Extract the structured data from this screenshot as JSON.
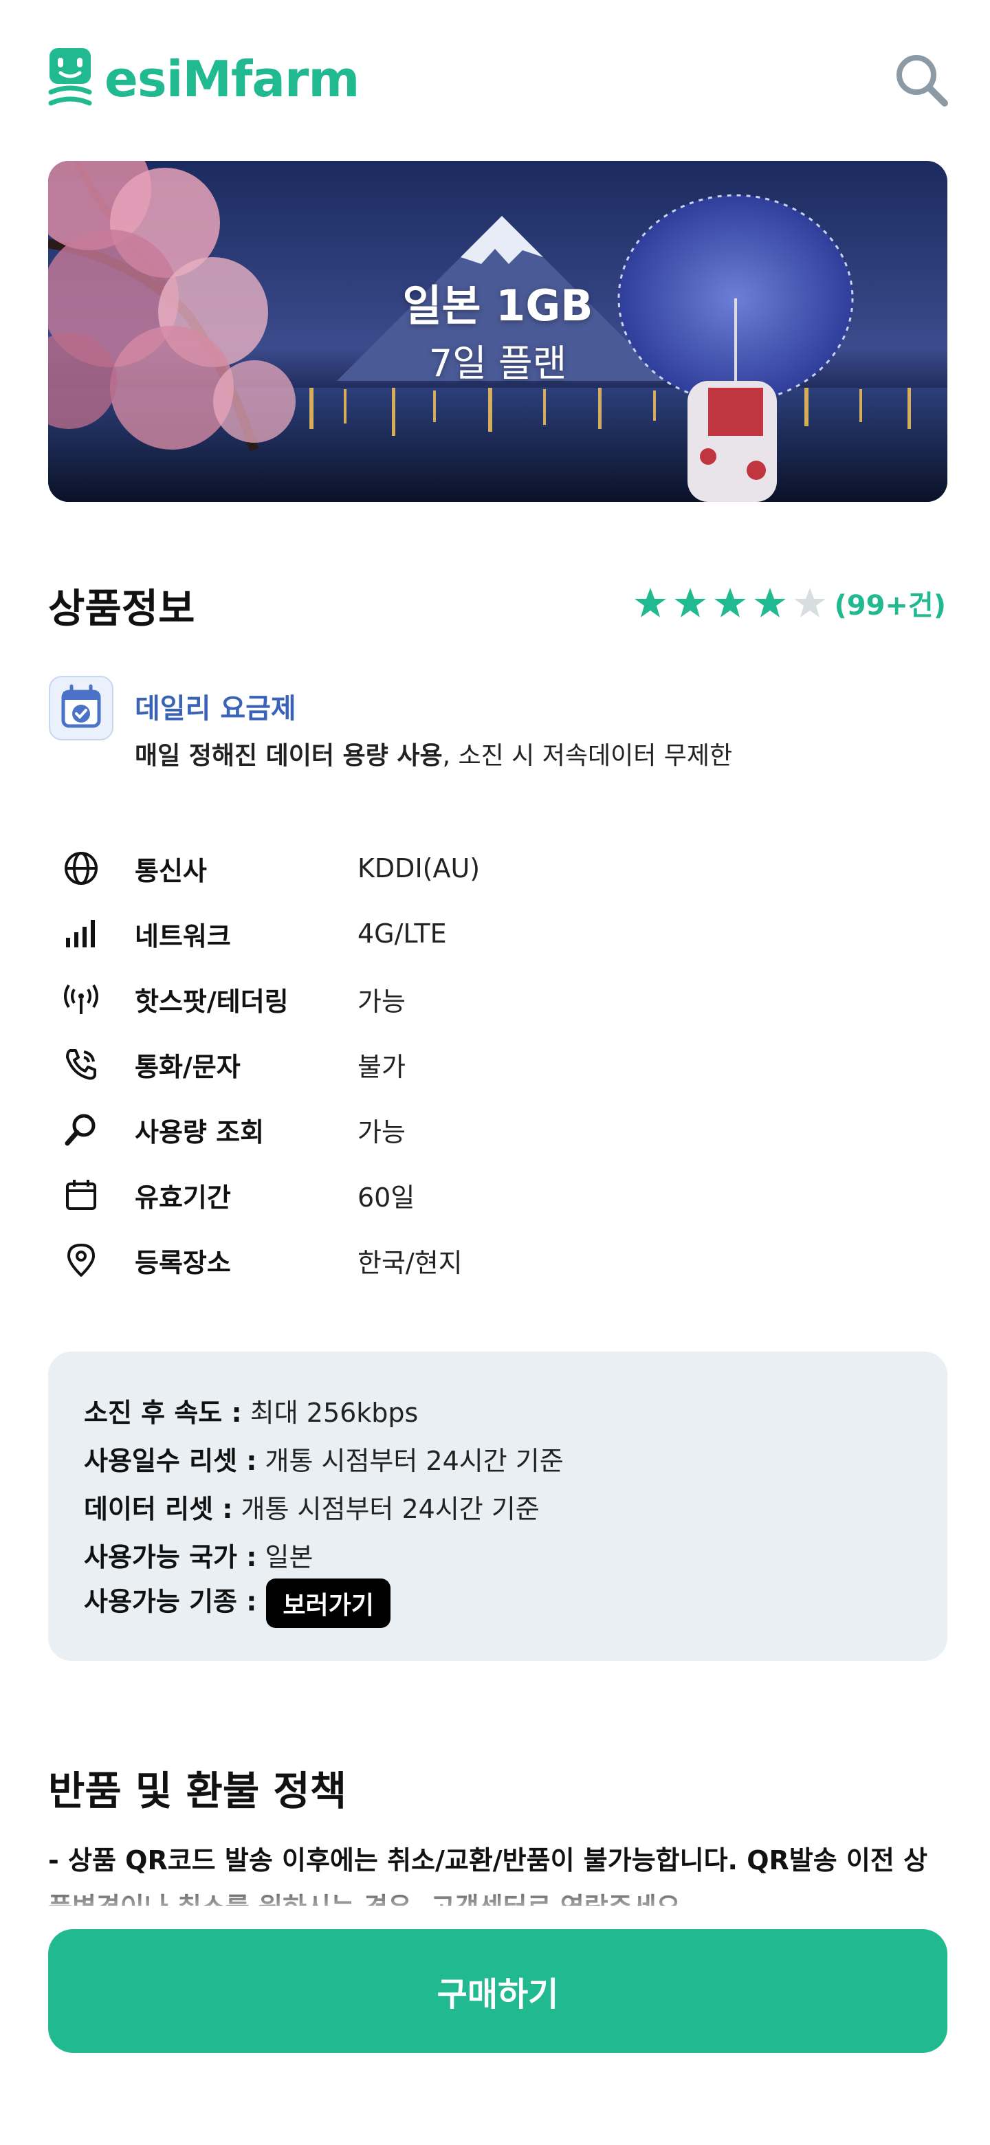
{
  "header": {
    "logo_text": "esiMfarm",
    "brand_color": "#21b98f",
    "search_icon": "search-icon"
  },
  "hero": {
    "title": "일본 1GB",
    "subtitle": "7일 플랜"
  },
  "product_info": {
    "title": "상품정보",
    "rating": {
      "stars": 4,
      "max": 5,
      "count_text": "(99+건)"
    }
  },
  "plan": {
    "icon": "calendar-check-icon",
    "name": "데일리 요금제",
    "desc_bold": "매일 정해진 데이터 용량 사용",
    "desc_rest": ", 소진 시 저속데이터 무제한"
  },
  "specs": [
    {
      "icon": "globe-icon",
      "label": "통신사",
      "value": "KDDI(AU)"
    },
    {
      "icon": "signal-bars-icon",
      "label": "네트워크",
      "value": "4G/LTE"
    },
    {
      "icon": "hotspot-icon",
      "label": "핫스팟/테더링",
      "value": "가능"
    },
    {
      "icon": "phone-icon",
      "label": "통화/문자",
      "value": "불가"
    },
    {
      "icon": "magnifier-icon",
      "label": "사용량 조회",
      "value": "가능"
    },
    {
      "icon": "calendar-icon",
      "label": "유효기간",
      "value": "60일"
    },
    {
      "icon": "location-pin-icon",
      "label": "등록장소",
      "value": "한국/현지"
    }
  ],
  "info_box": {
    "lines": [
      {
        "label": "소진 후 속도 :",
        "value": " 최대 256kbps"
      },
      {
        "label": "사용일수 리셋 :",
        "value": " 개통 시점부터 24시간 기준"
      },
      {
        "label": "데이터 리셋 :",
        "value": " 개통 시점부터 24시간 기준"
      },
      {
        "label": "사용가능 국가 :",
        "value": " 일본"
      },
      {
        "label": "사용가능 기종 :",
        "value": ""
      }
    ],
    "view_button": "보러가기"
  },
  "refund": {
    "title": "반품 및 환불 정책",
    "text": "- 상품 QR코드 발송 이후에는 취소/교환/반품이 불가능합니다. QR발송 이전 상품변경이나 취소를 원하시는 경우, 고객센터로 연락주세요."
  },
  "purchase": {
    "button": "구매하기"
  }
}
